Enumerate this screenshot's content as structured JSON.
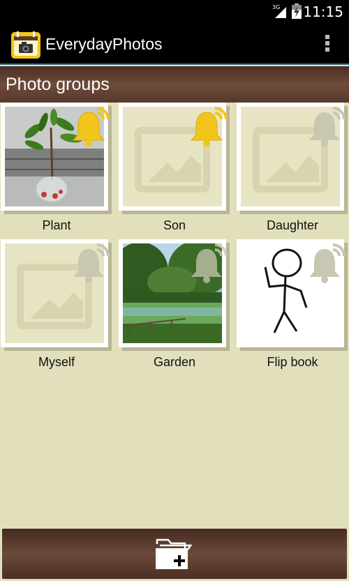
{
  "status": {
    "network": "3G",
    "time": "11:15"
  },
  "app": {
    "title": "EverydayPhotos"
  },
  "section": {
    "title": "Photo groups"
  },
  "groups": [
    {
      "label": "Plant",
      "thumbnail": "plant-photo",
      "alert": "active"
    },
    {
      "label": "Son",
      "thumbnail": "placeholder",
      "alert": "active"
    },
    {
      "label": "Daughter",
      "thumbnail": "placeholder",
      "alert": "inactive"
    },
    {
      "label": "Myself",
      "thumbnail": "placeholder",
      "alert": "inactive"
    },
    {
      "label": "Garden",
      "thumbnail": "garden-photo",
      "alert": "inactive"
    },
    {
      "label": "Flip book",
      "thumbnail": "stick-figure",
      "alert": "inactive"
    }
  ],
  "icons": {
    "app": "calendar-camera-icon",
    "overflow": "overflow-menu-icon",
    "bell": "notification-bell-icon",
    "add": "add-folder-icon"
  },
  "colors": {
    "background": "#e2dfbd",
    "header_brown": "#6e4c3c",
    "bell_active": "#f2c51a",
    "bell_inactive": "#c9c6b2"
  }
}
